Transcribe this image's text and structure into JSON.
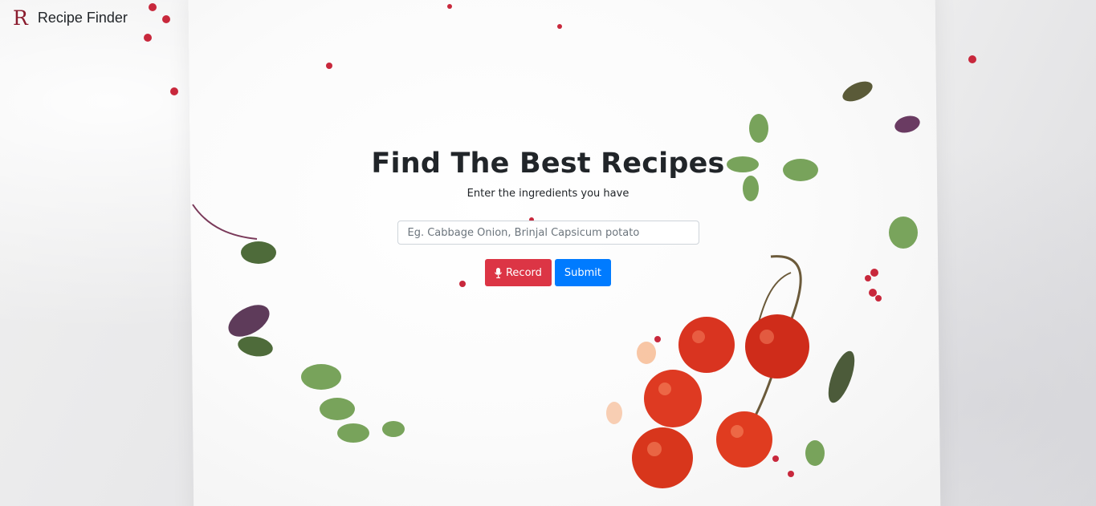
{
  "navbar": {
    "logo_letter": "R",
    "brand": "Recipe Finder"
  },
  "hero": {
    "title": "Find The Best Recipes",
    "subtitle": "Enter the ingredients you have"
  },
  "search": {
    "placeholder": "Eg. Cabbage Onion, Brinjal Capsicum potato",
    "value": ""
  },
  "buttons": {
    "record_label": "Record",
    "record_icon": "microphone-icon",
    "submit_label": "Submit"
  },
  "colors": {
    "brand": "#8a1b2d",
    "record": "#dc3545",
    "submit": "#007bff",
    "text": "#212529"
  }
}
